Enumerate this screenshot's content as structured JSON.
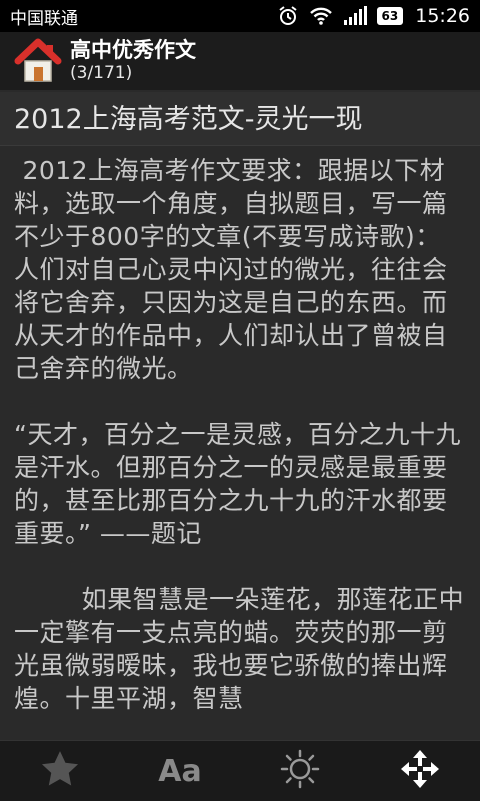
{
  "status": {
    "carrier": "中国联通",
    "battery": "63",
    "time": "15:26"
  },
  "header": {
    "title": "高中优秀作文",
    "position": "(3/171)",
    "home_icon": "home-icon"
  },
  "article": {
    "title": "2012上海高考范文-灵光一现",
    "paragraphs": [
      " 2012上海高考作文要求：跟据以下材料，选取一个角度，自拟题目，写一篇不少于800字的文章(不要写成诗歌)：人们对自己心灵中闪过的微光，往往会将它舍弃，只因为这是自己的东西。而从天才的作品中，人们却认出了曾被自己舍弃的微光。",
      "“天才，百分之一是灵感，百分之九十九是汗水。但那百分之一的灵感是最重要的，甚至比那百分之九十九的汗水都要重要。” ——题记",
      "        如果智慧是一朵莲花，那莲花正中一定擎有一支点亮的蜡。荧荧的那一剪光虽微弱暧昧，我也要它骄傲的捧出辉煌。十里平湖，智慧"
    ]
  },
  "toolbar": {
    "items": [
      {
        "icon": "star-icon"
      },
      {
        "icon": "font-size-icon",
        "glyph": "Aa"
      },
      {
        "icon": "brightness-icon"
      },
      {
        "icon": "fullscreen-icon"
      }
    ]
  },
  "colors": {
    "background": "#2a2a2a",
    "text": "#c8c8c8",
    "header": "#1c1c1c",
    "home_roof": "#d9302b"
  }
}
